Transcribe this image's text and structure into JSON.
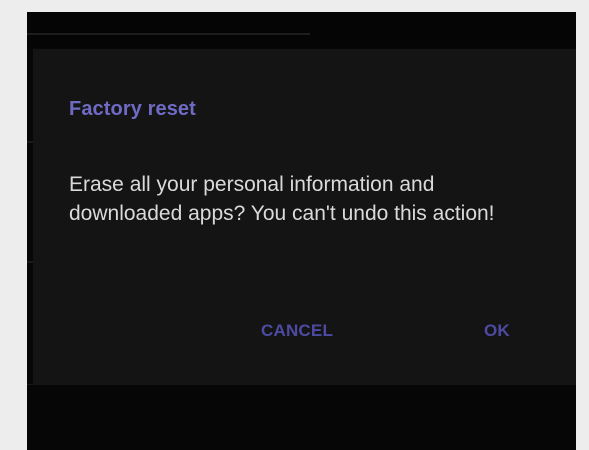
{
  "dialog": {
    "title": "Factory reset",
    "message": "Erase all your personal information and downloaded apps? You can't undo this action!",
    "buttons": {
      "cancel_label": "CANCEL",
      "ok_label": "OK"
    }
  },
  "colors": {
    "title": "#6f6bc4",
    "button_text": "#4d4aa2",
    "message_text": "#dadada",
    "dialog_bg": "#141414",
    "screen_bg": "#070707"
  }
}
